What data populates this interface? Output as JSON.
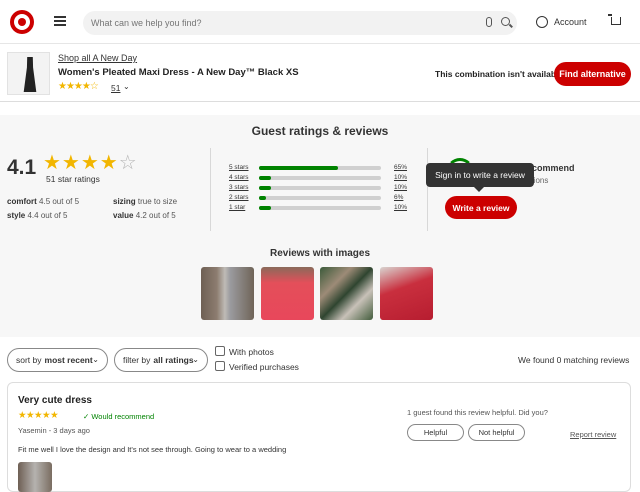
{
  "header": {
    "search_placeholder": "What can we help you find?",
    "account_label": "Account"
  },
  "product": {
    "shop_all_link": "Shop all A New Day",
    "title": "Women's Pleated Maxi Dress - A New Day™ Black XS",
    "stars": "★★★★☆",
    "rating_count": "51",
    "combination_message": "This combination isn't available",
    "find_alternative_label": "Find alternative"
  },
  "ratings": {
    "section_title": "Guest ratings & reviews",
    "average": "4.1",
    "stars_filled": "★★★★",
    "stars_empty": "☆",
    "star_count_label": "51 star ratings",
    "attributes": [
      {
        "name": "comfort",
        "value": "4.5 out of 5"
      },
      {
        "name": "sizing",
        "value": "true to size"
      },
      {
        "name": "style",
        "value": "4.4 out of 5"
      },
      {
        "name": "value",
        "value": "4.2 out of 5"
      }
    ],
    "distribution": [
      {
        "label": "5 stars",
        "percent": 65,
        "percent_label": "65%"
      },
      {
        "label": "4 stars",
        "percent": 10,
        "percent_label": "10%"
      },
      {
        "label": "3 stars",
        "percent": 10,
        "percent_label": "10%"
      },
      {
        "label": "2 stars",
        "percent": 6,
        "percent_label": "6%"
      },
      {
        "label": "1 star",
        "percent": 10,
        "percent_label": "10%"
      }
    ],
    "recommend_label": "ecommend",
    "recommend_sub": "ations",
    "tooltip": "Sign in to write a review",
    "write_review_label": "Write a review"
  },
  "reviews_with_images": {
    "title": "Reviews with images"
  },
  "filters": {
    "sort_prefix": "sort by",
    "sort_value": "most recent",
    "filter_prefix": "filter by",
    "filter_value": "all ratings",
    "with_photos": "With photos",
    "verified": "Verified purchases",
    "matching": "We found 0 matching reviews"
  },
  "review": {
    "title": "Very cute dress",
    "stars": "★★★★★",
    "would_recommend": "✓ Would recommend",
    "meta": "Yasemin - 3 days ago",
    "body": "Fit me well I love the design and It's not see through. Going to wear to a wedding",
    "helpful_question": "1 guest found this review helpful. Did you?",
    "helpful_label": "Helpful",
    "not_helpful_label": "Not helpful",
    "report_label": "Report review"
  },
  "colors": {
    "brand_red": "#cc0000",
    "star_gold": "#f2b600",
    "bar_green": "#008300"
  }
}
